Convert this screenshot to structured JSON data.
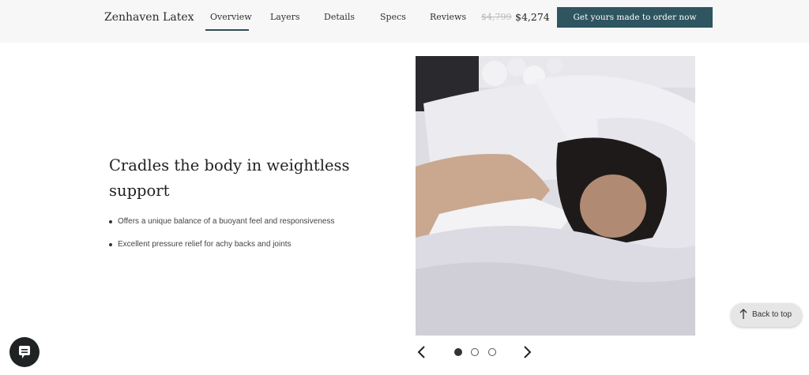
{
  "header": {
    "brand": "Zenhaven Latex",
    "nav": [
      "Overview",
      "Layers",
      "Details",
      "Specs",
      "Reviews"
    ],
    "active_nav": "Overview",
    "price_old": "$4,799",
    "price_new": "$4,274",
    "cta_label": "Get yours made to order now",
    "cta_color": "#2e5560"
  },
  "main": {
    "headline": "Cradles the body in weightless support",
    "bullets": [
      "Offers a unique balance of a buoyant feel and responsiveness",
      "Excellent pressure relief for achy backs and joints"
    ]
  },
  "carousel": {
    "slide_count": 3,
    "active_index": 0,
    "prev_icon": "chevron-left-icon",
    "next_icon": "chevron-right-icon"
  },
  "widgets": {
    "chat_icon": "chat-bubble-icon",
    "back_to_top": "Back to top",
    "back_to_top_icon": "arrow-up-icon"
  }
}
